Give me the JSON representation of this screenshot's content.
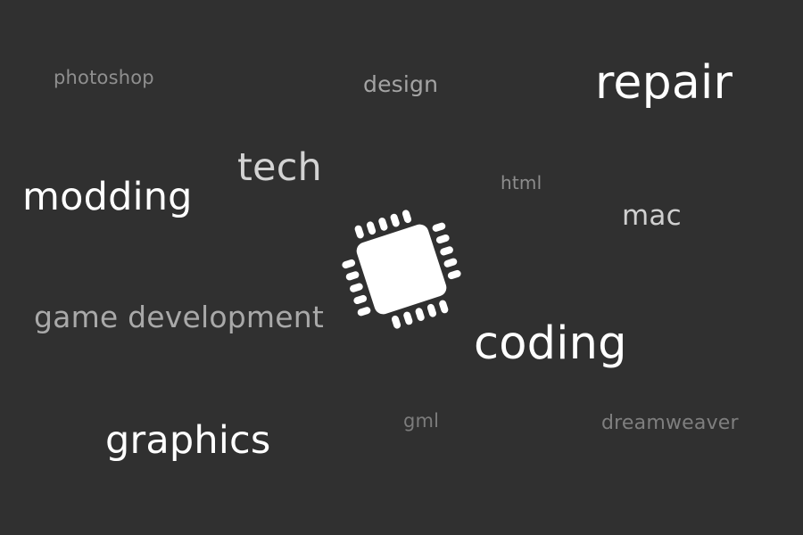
{
  "words": {
    "photoshop": "photoshop",
    "design": "design",
    "repair": "repair",
    "tech": "tech",
    "html": "html",
    "modding": "modding",
    "mac": "mac",
    "game_development": "game development",
    "coding": "coding",
    "gml": "gml",
    "dreamweaver": "dreamweaver",
    "graphics": "graphics"
  },
  "colors": {
    "background": "#303030",
    "bright": "#ffffff",
    "light": "#d6d6d6",
    "mid": "#a8a8a8",
    "dim": "#8a8a8a",
    "faint": "#7a7a7a",
    "chip": "#ffffff"
  },
  "icon": {
    "center": "cpu-chip-icon"
  }
}
